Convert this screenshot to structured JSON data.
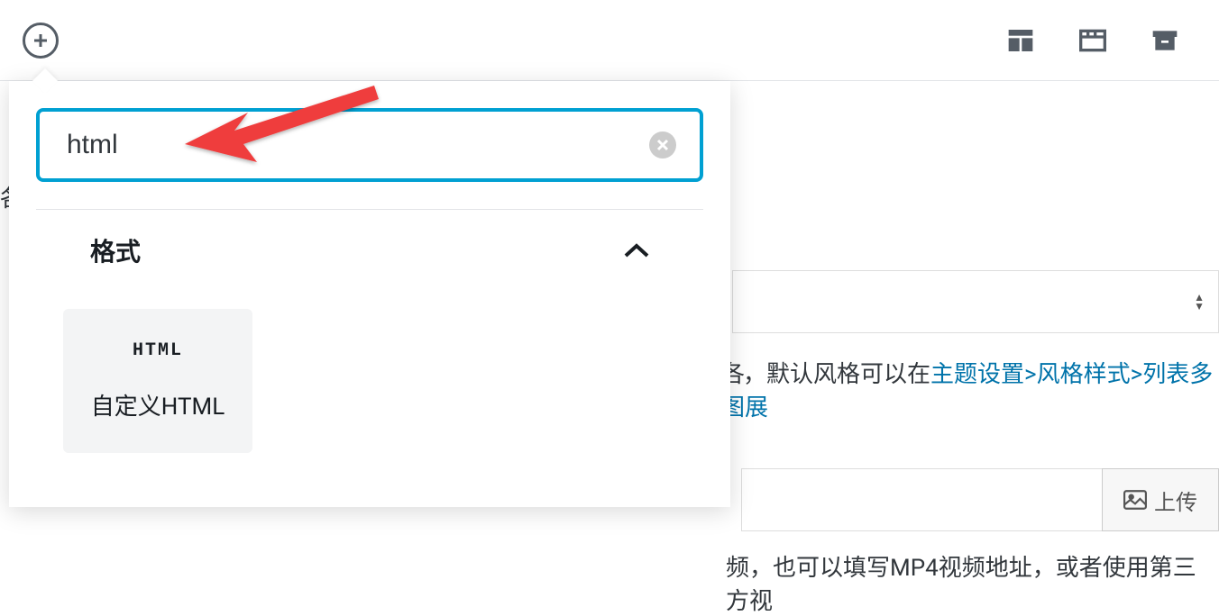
{
  "toolbar": {
    "add_label": "add"
  },
  "popover": {
    "search_value": "html",
    "category_title": "格式",
    "block": {
      "icon_text": "HTML",
      "label": "自定义HTML"
    }
  },
  "background": {
    "text1_prefix": "，默认风格可以在",
    "text1_link": "主题设置>风格样式>列表多图展",
    "text2": "频，也可以填写MP4视频地址，或者使用第三方视",
    "upload_label": "上传"
  }
}
